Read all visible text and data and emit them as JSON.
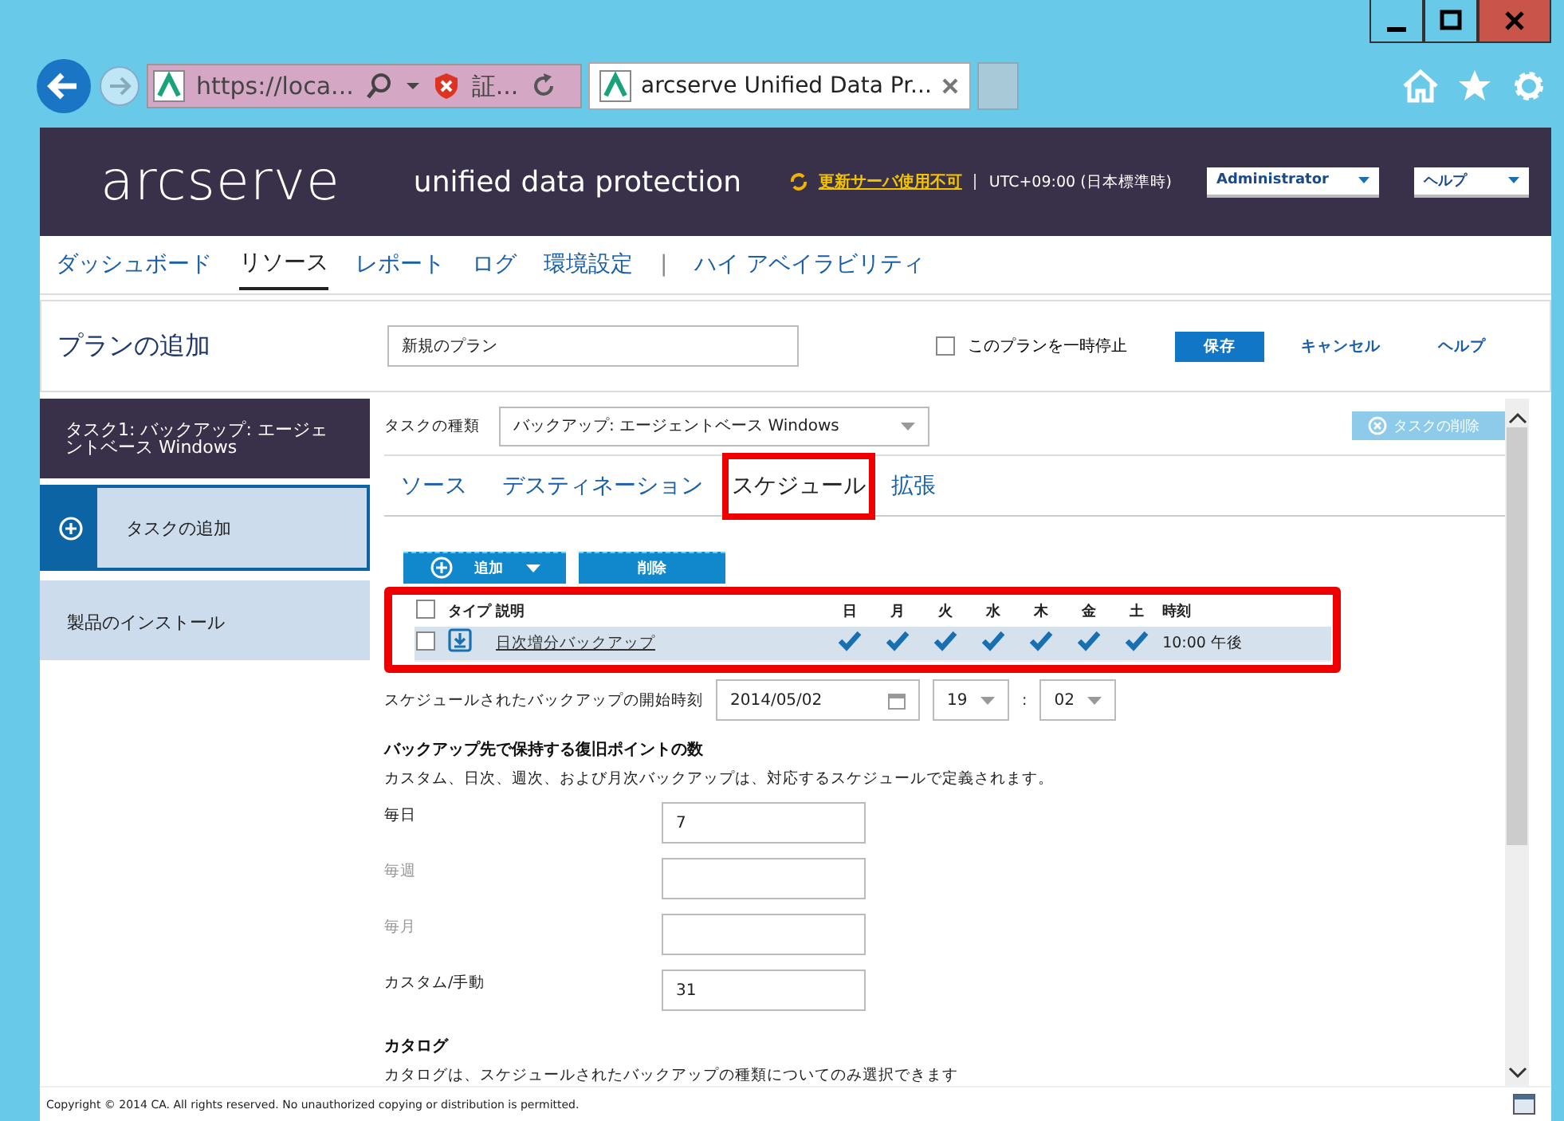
{
  "browser": {
    "address": "https://loca...",
    "cert": "証...",
    "tab_title": "arcserve Unified Data Pr..."
  },
  "header": {
    "logo": "arcserve",
    "product": "unified data protection",
    "update_link": "更新サーバ使用不可",
    "timezone": "UTC+09:00 (日本標準時)",
    "user_menu": "Administrator",
    "help_menu": "ヘルプ"
  },
  "nav": [
    {
      "kind": "link",
      "label": "ダッシュボード",
      "selected": false
    },
    {
      "kind": "link",
      "label": "リソース",
      "selected": true
    },
    {
      "kind": "link",
      "label": "レポート",
      "selected": false
    },
    {
      "kind": "link",
      "label": "ログ",
      "selected": false
    },
    {
      "kind": "link",
      "label": "環境設定",
      "selected": false
    },
    {
      "kind": "separator",
      "label": "|"
    },
    {
      "kind": "link",
      "label": "ハイ アベイラビリティ",
      "selected": false
    }
  ],
  "plan": {
    "title": "プランの追加",
    "name": "新規のプラン",
    "pause": {
      "label": "このプランを一時停止",
      "checked": false
    },
    "buttons": [
      {
        "kind": "primary",
        "label": "保存"
      },
      {
        "kind": "link",
        "label": "キャンセル"
      },
      {
        "kind": "link",
        "label": "ヘルプ"
      }
    ]
  },
  "sidebar": [
    {
      "kind": "task",
      "label": "タスク1: バックアップ: エージェントベース Windows"
    },
    {
      "kind": "add",
      "label": "タスクの追加"
    },
    {
      "kind": "install",
      "label": "製品のインストール"
    }
  ],
  "task_type": {
    "label": "タスクの種類",
    "value": "バックアップ: エージェントベース Windows",
    "delete": "タスクの削除",
    "delete_disabled": true
  },
  "tabs": [
    {
      "label": "ソース",
      "selected": false,
      "highlighted": false
    },
    {
      "label": "デスティネーション",
      "selected": false,
      "highlighted": false
    },
    {
      "label": "スケジュール",
      "selected": true,
      "highlighted": true
    },
    {
      "label": "拡張",
      "selected": false,
      "highlighted": false
    }
  ],
  "toolbar": {
    "add": "追加",
    "delete": "削除"
  },
  "schedule_table": {
    "highlighted": true,
    "all_checked": false,
    "columns": [
      "タイプ",
      "説明",
      "日",
      "月",
      "火",
      "水",
      "木",
      "金",
      "土",
      "時刻"
    ],
    "rows": [
      {
        "checked": false,
        "selected": true,
        "description": "日次増分バックアップ",
        "days": [
          true,
          true,
          true,
          true,
          true,
          true,
          true
        ],
        "time": "10:00 午後"
      }
    ]
  },
  "start_time": {
    "label": "スケジュールされたバックアップの開始時刻",
    "date": "2014/05/02",
    "hour": "19",
    "separator": ":",
    "minute": "02"
  },
  "retention": {
    "title": "バックアップ先で保持する復旧ポイントの数",
    "note": "カスタム、日次、週次、および月次バックアップは、対応するスケジュールで定義されます。",
    "fields": [
      {
        "label": "毎日",
        "value": "7",
        "disabled": false
      },
      {
        "label": "毎週",
        "disabled": true
      },
      {
        "label": "毎月",
        "disabled": true
      },
      {
        "label": "カスタム/手動",
        "value": "31",
        "disabled": false
      }
    ]
  },
  "catalog": {
    "title": "カタログ",
    "note": "カタログは、スケジュールされたバックアップの種類についてのみ選択できます"
  },
  "footer": "Copyright © 2014 CA. All rights reserved. No unauthorized copying or distribution is permitted."
}
